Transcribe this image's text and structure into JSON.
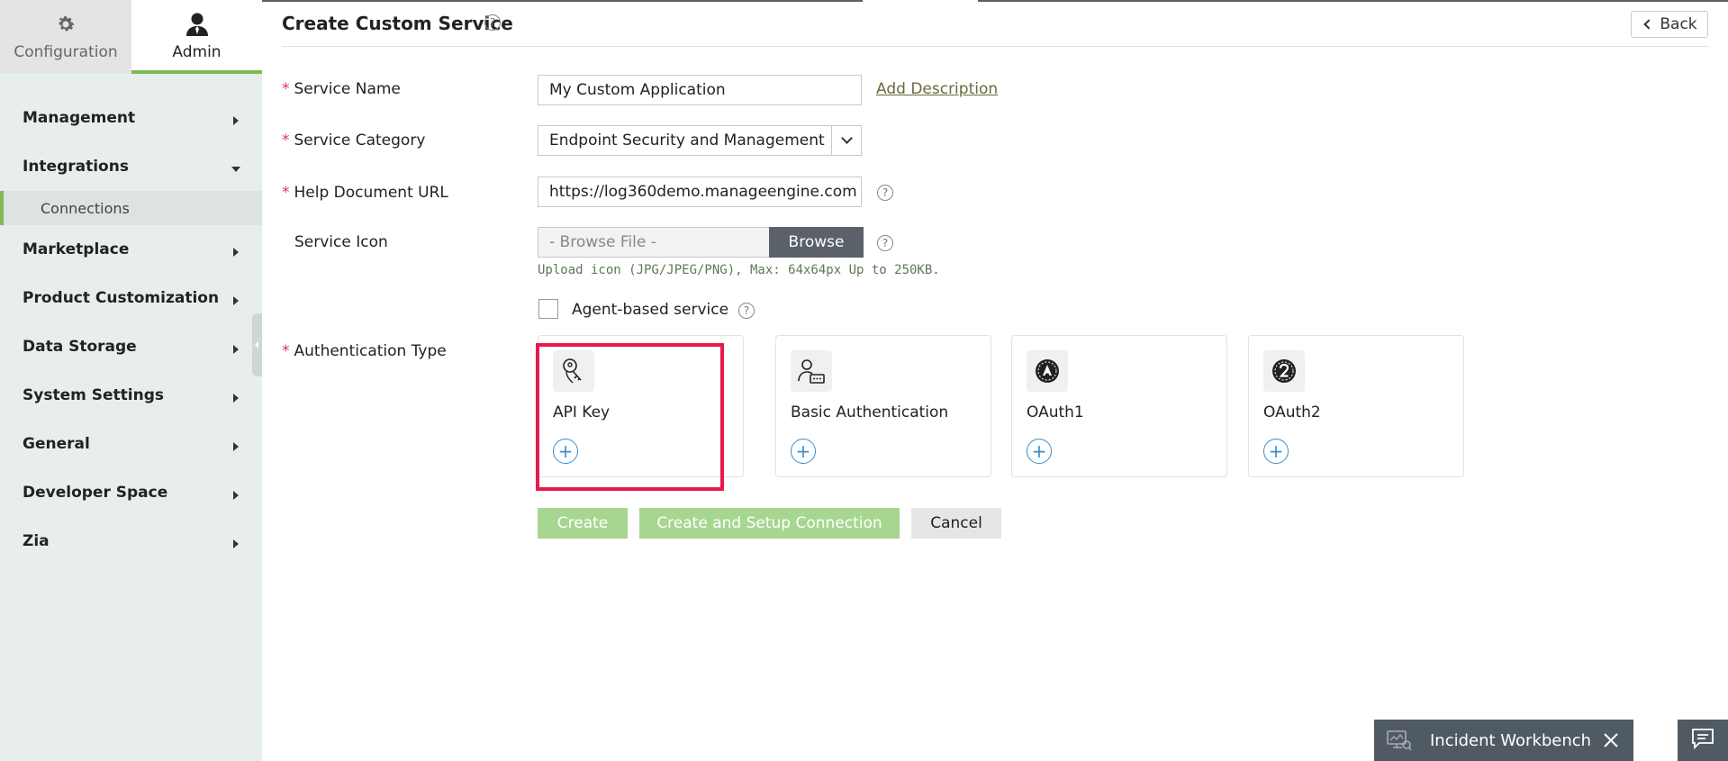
{
  "sidebar": {
    "tabs": [
      {
        "label": "Configuration",
        "icon": "gear-icon"
      },
      {
        "label": "Admin",
        "icon": "user-icon"
      }
    ],
    "items": [
      {
        "label": "Management"
      },
      {
        "label": "Integrations"
      },
      {
        "label": "Connections"
      },
      {
        "label": "Marketplace"
      },
      {
        "label": "Product Customization"
      },
      {
        "label": "Data Storage"
      },
      {
        "label": "System Settings"
      },
      {
        "label": "General"
      },
      {
        "label": "Developer Space"
      },
      {
        "label": "Zia"
      }
    ]
  },
  "header": {
    "title": "Create Custom Service",
    "help": "?",
    "back_label": "Back"
  },
  "form": {
    "service_name": {
      "label": "Service Name",
      "value": "My Custom Application",
      "required": "*"
    },
    "add_description": "Add Description",
    "service_category": {
      "label": "Service Category",
      "value": "Endpoint Security and Management",
      "required": "*"
    },
    "help_doc_url": {
      "label": "Help Document URL",
      "value": "https://log360demo.manageengine.com",
      "required": "*"
    },
    "service_icon": {
      "label": "Service Icon",
      "placeholder": "- Browse File -",
      "browse_label": "Browse"
    },
    "upload_hint": "Upload icon (JPG/JPEG/PNG), Max: 64x64px Up to 250KB.",
    "agent_based": {
      "label": "Agent-based service",
      "checked": false
    },
    "auth_type": {
      "label": "Authentication Type",
      "required": "*"
    },
    "auth_options": [
      {
        "label": "API Key",
        "icon": "key-icon",
        "selected": true
      },
      {
        "label": "Basic Authentication",
        "icon": "user-lock-icon"
      },
      {
        "label": "OAuth1",
        "icon": "oauth1-icon"
      },
      {
        "label": "OAuth2",
        "icon": "oauth2-icon"
      }
    ],
    "add_symbol": "+"
  },
  "actions": {
    "create": "Create",
    "create_setup": "Create and Setup Connection",
    "cancel": "Cancel"
  },
  "workbench": {
    "label": "Incident Workbench"
  },
  "colors": {
    "accent_green": "#7cbb50",
    "button_green": "#a7d690",
    "highlight": "#e8194e",
    "required": "#e2344c",
    "dark_bar": "#505a62"
  }
}
